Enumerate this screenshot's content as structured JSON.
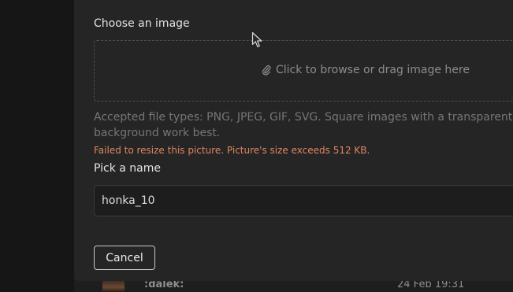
{
  "upload": {
    "label": "Choose an image",
    "dropzone_text": "Click to browse or drag image here",
    "dropzone_icon": "paperclip-icon",
    "help_text": "Accepted file types: PNG, JPEG, GIF, SVG. Square images with a transparent background work best.",
    "error": "Failed to resize this picture. Picture's size exceeds 512 KB."
  },
  "name_field": {
    "label": "Pick a name",
    "value": "honka_10"
  },
  "actions": {
    "cancel_label": "Cancel"
  },
  "background_row": {
    "emoji_name": ":dalek:",
    "date": "24 Feb 19:31"
  },
  "colors": {
    "error": "#e0865f",
    "modal_bg": "#252526",
    "page_bg": "#1b1b1c"
  }
}
